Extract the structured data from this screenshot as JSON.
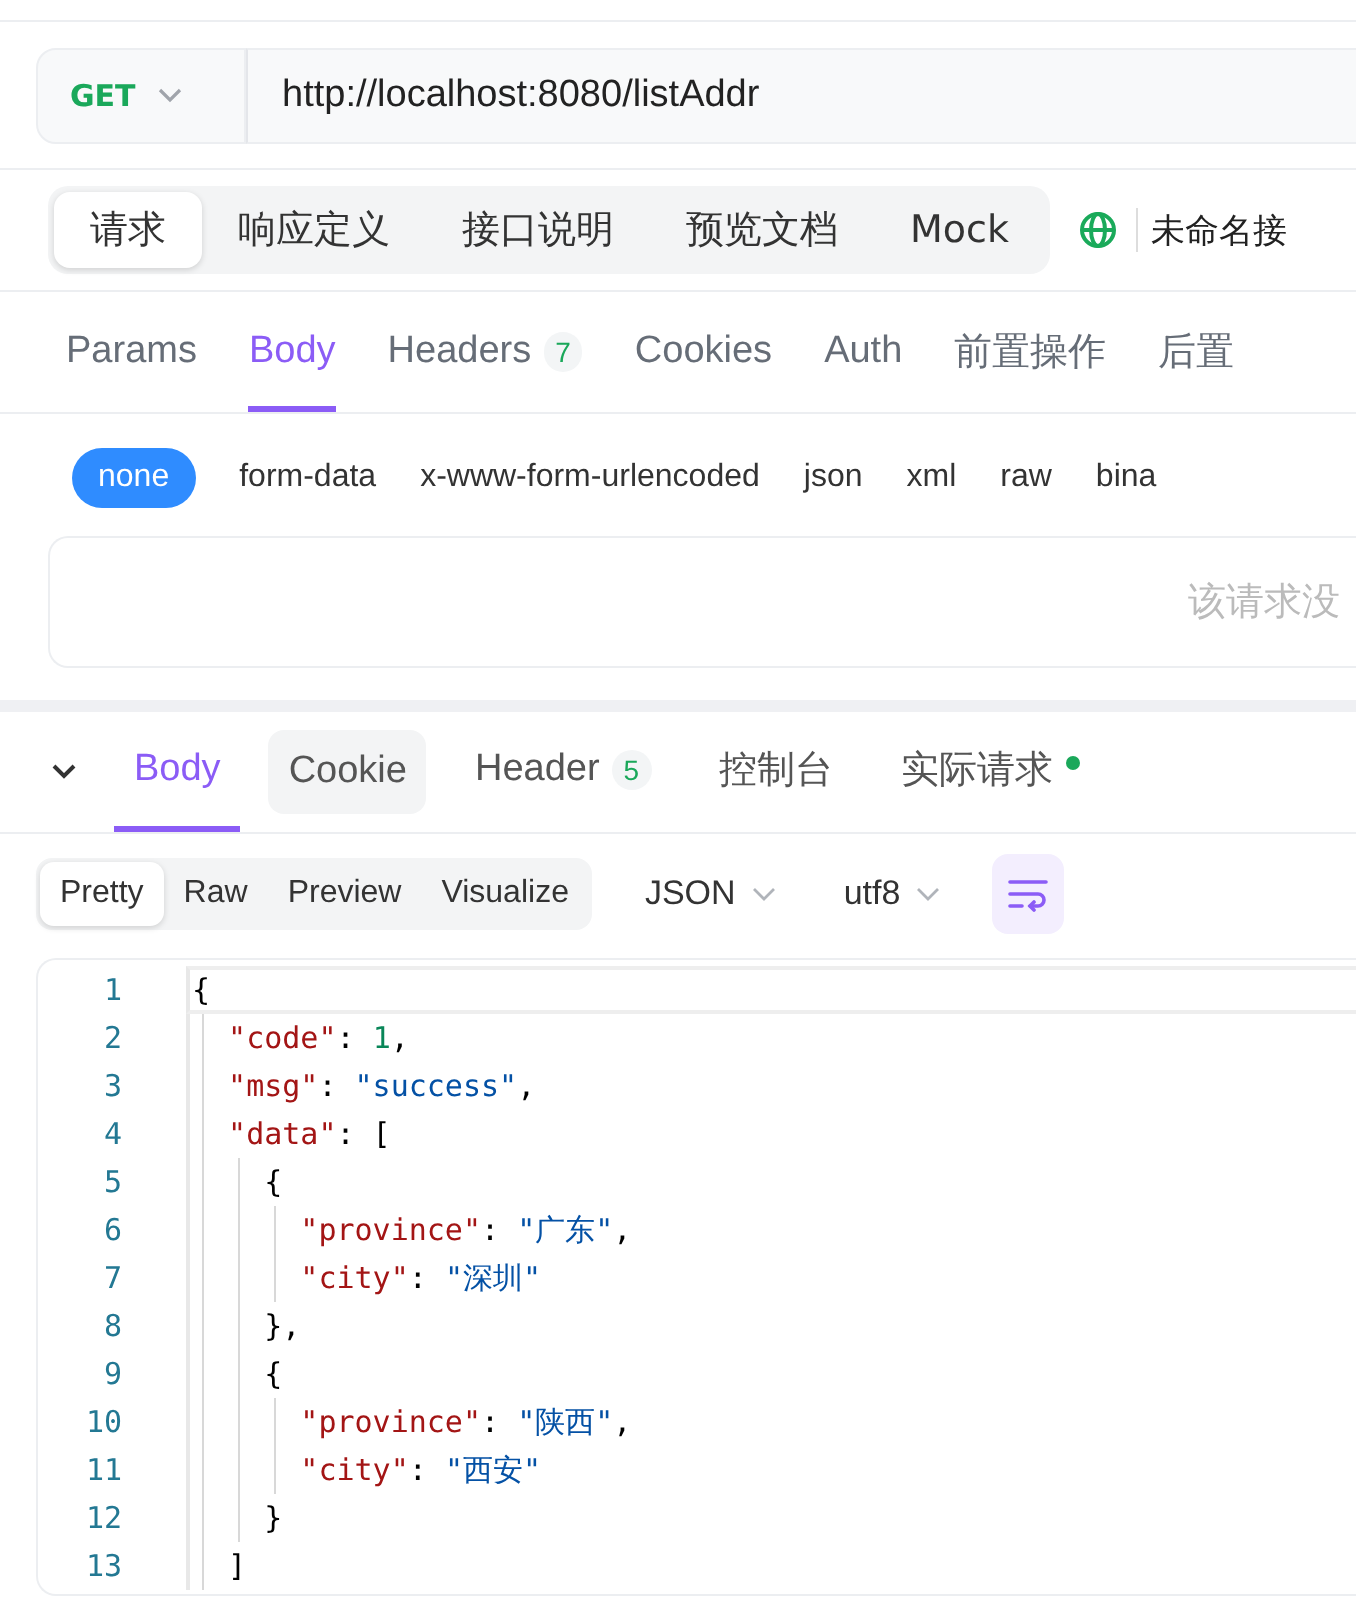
{
  "request": {
    "method": "GET",
    "url": "http://localhost:8080/listAddr"
  },
  "mode_tabs": [
    {
      "label": "请求",
      "selected": true
    },
    {
      "label": "响应定义",
      "selected": false
    },
    {
      "label": "接口说明",
      "selected": false
    },
    {
      "label": "预览文档",
      "selected": false
    },
    {
      "label": "Mock",
      "selected": false
    }
  ],
  "environment": {
    "name": "未命名接"
  },
  "request_tabs": [
    {
      "label": "Params",
      "selected": false
    },
    {
      "label": "Body",
      "selected": true
    },
    {
      "label": "Headers",
      "count": "7",
      "selected": false
    },
    {
      "label": "Cookies",
      "selected": false
    },
    {
      "label": "Auth",
      "selected": false
    },
    {
      "label": "前置操作",
      "selected": false
    },
    {
      "label": "后置",
      "selected": false
    }
  ],
  "body_types": [
    {
      "label": "none",
      "selected": true
    },
    {
      "label": "form-data",
      "selected": false
    },
    {
      "label": "x-www-form-urlencoded",
      "selected": false
    },
    {
      "label": "json",
      "selected": false
    },
    {
      "label": "xml",
      "selected": false
    },
    {
      "label": "raw",
      "selected": false
    },
    {
      "label": "bina",
      "selected": false
    }
  ],
  "body_empty_message": "该请求没",
  "response_tabs": [
    {
      "label": "Body",
      "selected": true,
      "hovered": false
    },
    {
      "label": "Cookie",
      "selected": false,
      "hovered": true
    },
    {
      "label": "Header",
      "count": "5",
      "selected": false,
      "hovered": false
    },
    {
      "label": "控制台",
      "selected": false,
      "hovered": false
    },
    {
      "label": "实际请求",
      "selected": false,
      "hovered": false,
      "dot": true
    }
  ],
  "view_modes": [
    {
      "label": "Pretty",
      "selected": true
    },
    {
      "label": "Raw",
      "selected": false
    },
    {
      "label": "Preview",
      "selected": false
    },
    {
      "label": "Visualize",
      "selected": false
    }
  ],
  "format": "JSON",
  "encoding": "utf8",
  "wrap": true,
  "code_lines": [
    {
      "number": "1",
      "current": true,
      "tokens": [
        {
          "kind": "punct",
          "text": "{"
        }
      ]
    },
    {
      "number": "2",
      "current": false,
      "tokens": [
        {
          "kind": "key",
          "text": "  \"code\""
        },
        {
          "kind": "punct",
          "text": ": "
        },
        {
          "kind": "number",
          "text": "1"
        },
        {
          "kind": "punct",
          "text": ","
        }
      ]
    },
    {
      "number": "3",
      "current": false,
      "tokens": [
        {
          "kind": "key",
          "text": "  \"msg\""
        },
        {
          "kind": "punct",
          "text": ": "
        },
        {
          "kind": "string",
          "text": "\"success\""
        },
        {
          "kind": "punct",
          "text": ","
        }
      ]
    },
    {
      "number": "4",
      "current": false,
      "tokens": [
        {
          "kind": "key",
          "text": "  \"data\""
        },
        {
          "kind": "punct",
          "text": ": ["
        }
      ]
    },
    {
      "number": "5",
      "current": false,
      "tokens": [
        {
          "kind": "punct",
          "text": "    {"
        }
      ]
    },
    {
      "number": "6",
      "current": false,
      "tokens": [
        {
          "kind": "key",
          "text": "      \"province\""
        },
        {
          "kind": "punct",
          "text": ": "
        },
        {
          "kind": "string",
          "text": "\"广东\""
        },
        {
          "kind": "punct",
          "text": ","
        }
      ]
    },
    {
      "number": "7",
      "current": false,
      "tokens": [
        {
          "kind": "key",
          "text": "      \"city\""
        },
        {
          "kind": "punct",
          "text": ": "
        },
        {
          "kind": "string",
          "text": "\"深圳\""
        }
      ]
    },
    {
      "number": "8",
      "current": false,
      "tokens": [
        {
          "kind": "punct",
          "text": "    },"
        }
      ]
    },
    {
      "number": "9",
      "current": false,
      "tokens": [
        {
          "kind": "punct",
          "text": "    {"
        }
      ]
    },
    {
      "number": "10",
      "current": false,
      "tokens": [
        {
          "kind": "key",
          "text": "      \"province\""
        },
        {
          "kind": "punct",
          "text": ": "
        },
        {
          "kind": "string",
          "text": "\"陕西\""
        },
        {
          "kind": "punct",
          "text": ","
        }
      ]
    },
    {
      "number": "11",
      "current": false,
      "tokens": [
        {
          "kind": "key",
          "text": "      \"city\""
        },
        {
          "kind": "punct",
          "text": ": "
        },
        {
          "kind": "string",
          "text": "\"西安\""
        }
      ]
    },
    {
      "number": "12",
      "current": false,
      "tokens": [
        {
          "kind": "punct",
          "text": "    }"
        }
      ]
    },
    {
      "number": "13",
      "current": false,
      "tokens": [
        {
          "kind": "punct",
          "text": "  ]"
        }
      ]
    }
  ]
}
